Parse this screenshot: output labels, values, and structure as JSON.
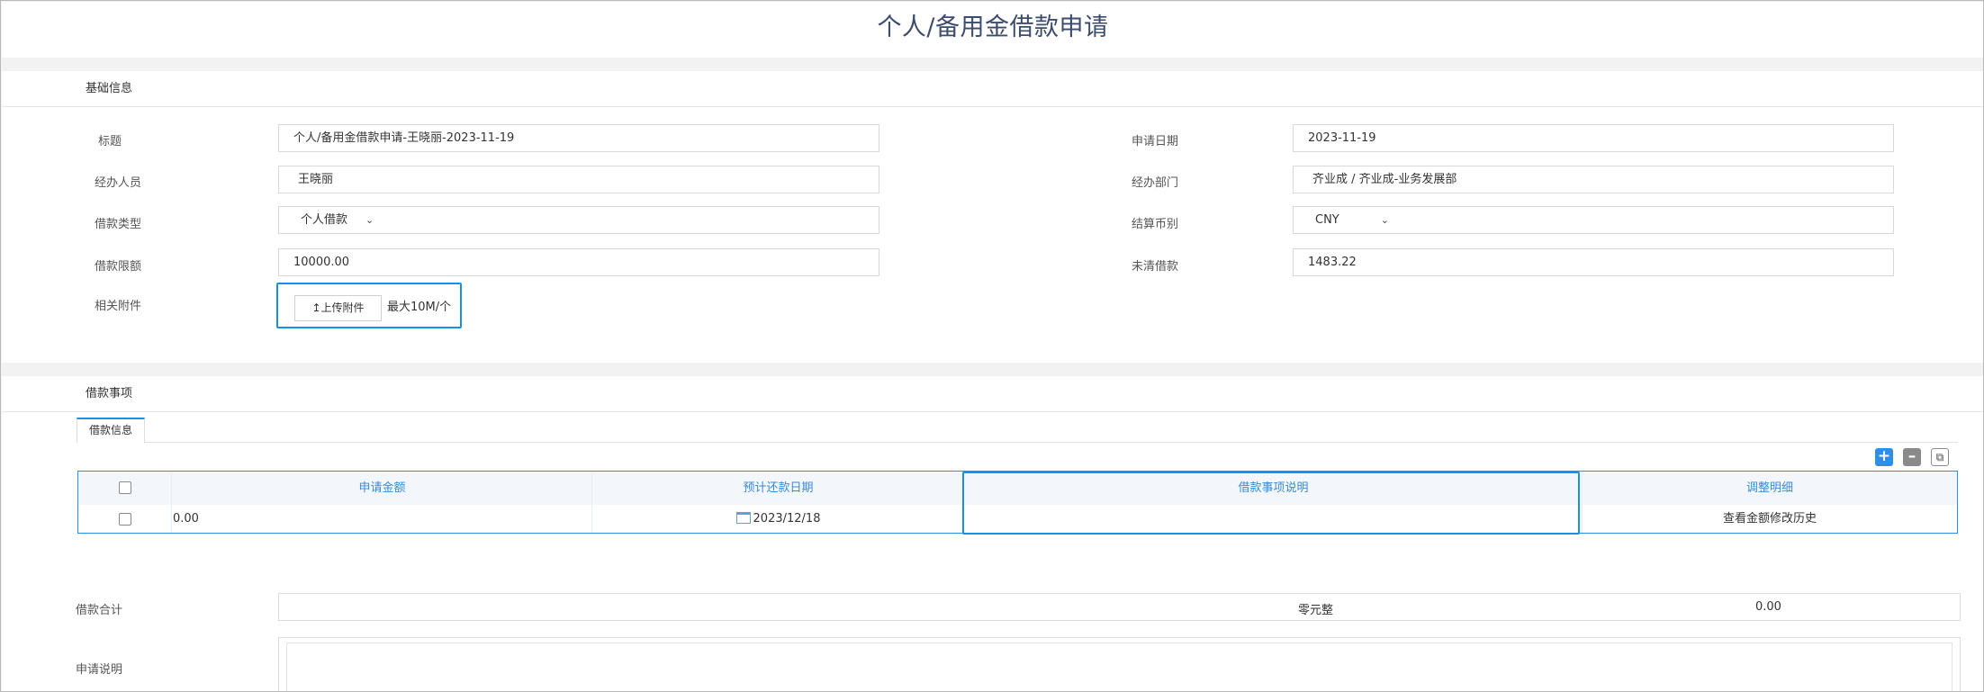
{
  "page": {
    "title": "个人/备用金借款申请"
  },
  "basic": {
    "section_title": "基础信息",
    "subject_label": "标题",
    "subject_value": "个人/备用金借款申请-王晓丽-2023-11-19",
    "apply_date_label": "申请日期",
    "apply_date_value": "2023-11-19",
    "handler_label": "经办人员",
    "handler_value": "王晓丽",
    "department_label": "经办部门",
    "department_value": "齐业成 /  齐业成-业务发展部",
    "loan_type_label": "借款类型",
    "loan_type_value": "个人借款",
    "currency_label": "结算币别",
    "currency_value": "CNY",
    "limit_label": "借款限额",
    "limit_value": "10000.00",
    "outstanding_label": "未清借款",
    "outstanding_value": "1483.22",
    "attachment_label": "相关附件",
    "upload_button": "上传附件",
    "upload_hint": "最大10M/个"
  },
  "items": {
    "section_title": "借款事项",
    "tab_label": "借款信息",
    "columns": [
      "申请金额",
      "预计还款日期",
      "借款事项说明",
      "调整明细"
    ],
    "rows": [
      {
        "amount": "0.00",
        "repay_date": "2023/12/18",
        "description": "",
        "adjust_link": "查看金额修改历史"
      }
    ],
    "total_label": "借款合计",
    "total_words": "零元整",
    "total_amount": "0.00",
    "note_label": "申请说明",
    "note_value": ""
  },
  "toolbar": {
    "icons": [
      "add-icon",
      "remove-icon",
      "copy-icon"
    ]
  },
  "colors": {
    "accent": "#1890e8",
    "title": "#3c4c6e",
    "header_text": "#3a8ad6"
  }
}
